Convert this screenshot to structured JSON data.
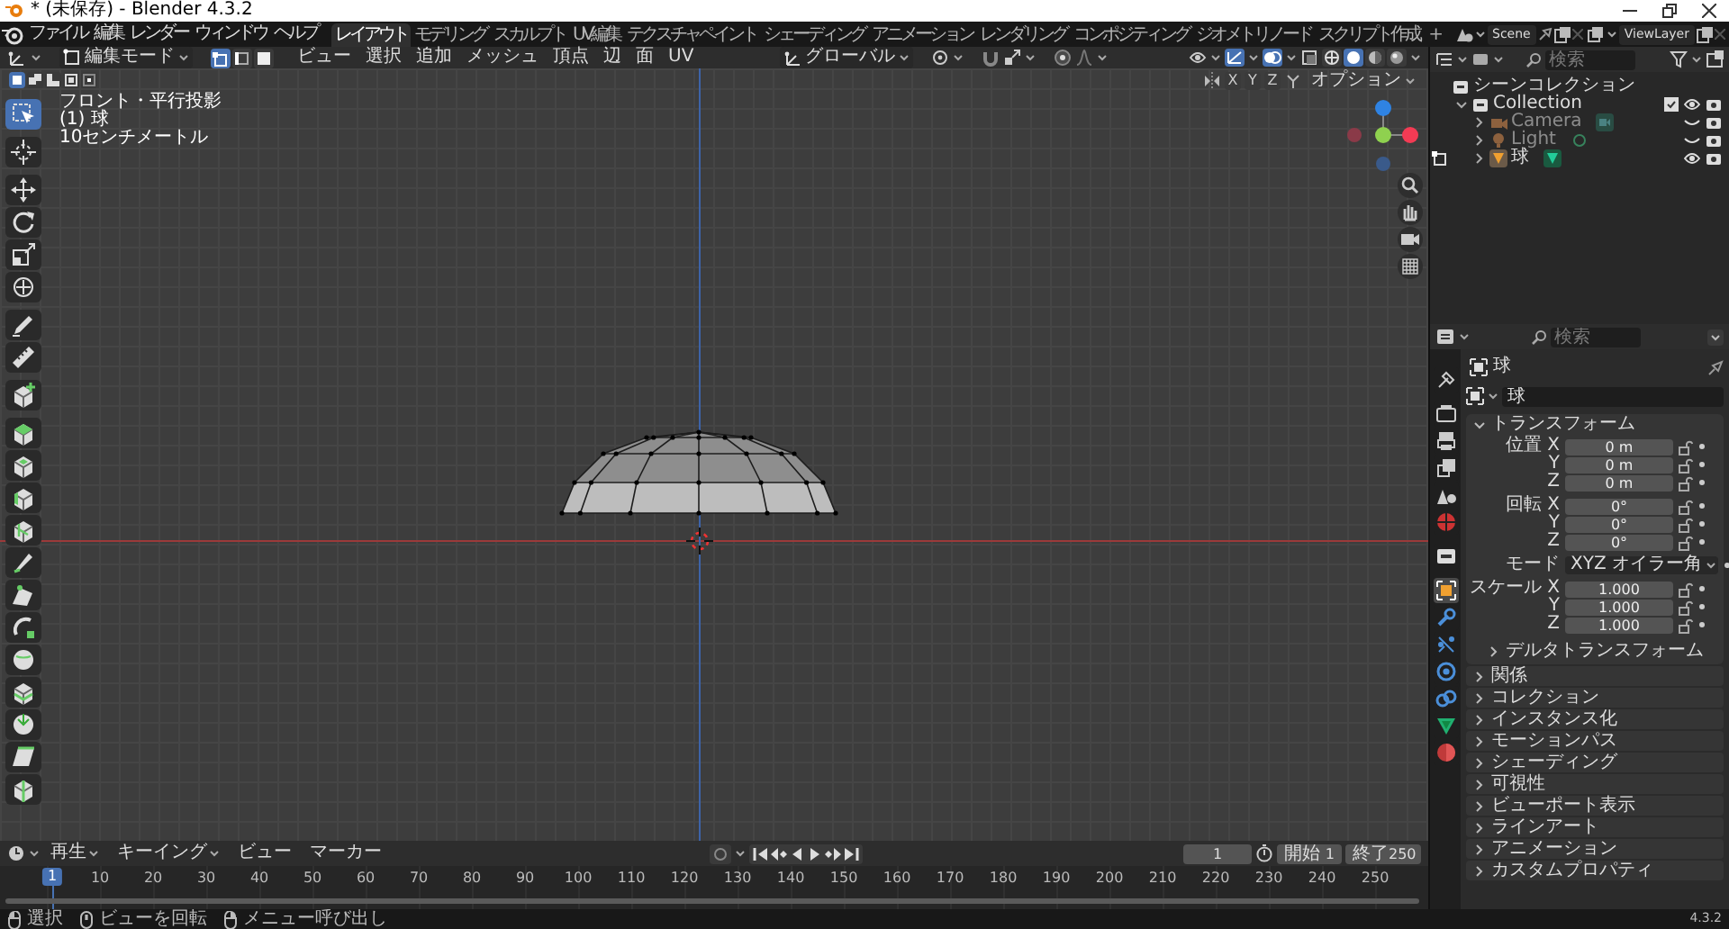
{
  "window": {
    "title": "* (未保存) - Blender 4.3.2"
  },
  "menu": [
    "ファイル",
    "編集",
    "レンダー",
    "ウィンドウ",
    "ヘルプ"
  ],
  "workspaces": [
    {
      "label": "レイアウト",
      "selected": true
    },
    {
      "label": "モデリング",
      "selected": false
    },
    {
      "label": "スカルプト",
      "selected": false
    },
    {
      "label": "UV編集",
      "selected": false
    },
    {
      "label": "テクスチャペイント",
      "selected": false
    },
    {
      "label": "シェーディング",
      "selected": false
    },
    {
      "label": "アニメーション",
      "selected": false
    },
    {
      "label": "レンダリング",
      "selected": false
    },
    {
      "label": "コンポジティング",
      "selected": false
    },
    {
      "label": "ジオメトリノード",
      "selected": false
    },
    {
      "label": "スクリプト作成",
      "selected": false
    }
  ],
  "add_workspace": "+",
  "scene": {
    "name": "Scene"
  },
  "view_layer": {
    "name": "ViewLayer"
  },
  "viewport": {
    "mode": "編集モード",
    "select_modes": [
      {
        "kind": "vertex",
        "selected": true
      },
      {
        "kind": "edge",
        "selected": false
      },
      {
        "kind": "face",
        "selected": false
      }
    ],
    "menus": [
      "ビュー",
      "選択",
      "追加",
      "メッシュ",
      "頂点",
      "辺",
      "面",
      "UV"
    ],
    "orientation": "グローバル",
    "select_ops": [
      {
        "kind": "set",
        "selected": true
      },
      {
        "kind": "extend",
        "selected": false
      },
      {
        "kind": "subtract",
        "selected": false
      },
      {
        "kind": "invert",
        "selected": false
      },
      {
        "kind": "intersect",
        "selected": false
      }
    ],
    "mirror_axes": [
      {
        "label": "X",
        "on": false
      },
      {
        "label": "Y",
        "on": false
      },
      {
        "label": "Z",
        "on": false
      }
    ],
    "options": "オプション",
    "gizmos_on": true,
    "overlays_on": true,
    "shading": [
      {
        "kind": "wireframe",
        "selected": false
      },
      {
        "kind": "solid",
        "selected": true
      },
      {
        "kind": "material",
        "selected": false
      },
      {
        "kind": "rendered",
        "selected": false
      }
    ],
    "info": [
      "フロント・平行投影",
      "(1) 球",
      "10センチメートル"
    ],
    "tool_groups": [
      [
        {
          "kind": "select",
          "selected": true
        }
      ],
      [
        {
          "kind": "cursor",
          "selected": false
        }
      ],
      [
        {
          "kind": "move",
          "selected": false
        },
        {
          "kind": "rotate",
          "selected": false
        },
        {
          "kind": "scale",
          "selected": false
        },
        {
          "kind": "transform",
          "selected": false
        }
      ],
      [
        {
          "kind": "annotate",
          "selected": false
        },
        {
          "kind": "measure",
          "selected": false
        }
      ],
      [
        {
          "kind": "add_cube",
          "selected": false
        }
      ],
      [
        {
          "kind": "extrude",
          "selected": false
        },
        {
          "kind": "inset",
          "selected": false
        },
        {
          "kind": "bevel",
          "selected": false
        },
        {
          "kind": "loop_cut",
          "selected": false
        },
        {
          "kind": "knife",
          "selected": false
        },
        {
          "kind": "poly_build",
          "selected": false
        },
        {
          "kind": "spin",
          "selected": false
        },
        {
          "kind": "smooth",
          "selected": false
        },
        {
          "kind": "edge_slide",
          "selected": false
        },
        {
          "kind": "shrink",
          "selected": false
        },
        {
          "kind": "shear",
          "selected": false
        },
        {
          "kind": "rip",
          "selected": false
        }
      ]
    ]
  },
  "outliner": {
    "search": {
      "placeholder": "検索"
    },
    "root": "シーンコレクション",
    "items": [
      {
        "label": "Collection",
        "kind": "collection",
        "expanded": true,
        "checked": true,
        "visible": true,
        "children": [
          {
            "label": "Camera",
            "kind": "camera",
            "expanded": false,
            "visible": false,
            "editing": false
          },
          {
            "label": "Light",
            "kind": "light",
            "expanded": false,
            "visible": false,
            "editing": false
          },
          {
            "label": "球",
            "kind": "mesh",
            "expanded": false,
            "visible": true,
            "editing": true
          }
        ]
      }
    ]
  },
  "properties": {
    "search": {
      "placeholder": "検索"
    },
    "tabs": [
      {
        "kind": "tool",
        "selected": false
      },
      {
        "kind": "render",
        "selected": false
      },
      {
        "kind": "output",
        "selected": false
      },
      {
        "kind": "view_layer",
        "selected": false
      },
      {
        "kind": "scene",
        "selected": false
      },
      {
        "kind": "world",
        "selected": false
      },
      {
        "kind": "collection",
        "selected": false
      },
      {
        "kind": "object",
        "selected": true
      },
      {
        "kind": "modifiers",
        "selected": false
      },
      {
        "kind": "particles",
        "selected": false
      },
      {
        "kind": "physics",
        "selected": false
      },
      {
        "kind": "constraints",
        "selected": false
      },
      {
        "kind": "data",
        "selected": false
      },
      {
        "kind": "material",
        "selected": false
      }
    ],
    "object": "球",
    "name": "球",
    "transform": {
      "title": "トランスフォーム",
      "expanded": true,
      "groups": [
        {
          "rows": [
            {
              "kind": "field",
              "label": "位置 X",
              "value": "0 m"
            },
            {
              "kind": "field",
              "label": "Y",
              "value": "0 m"
            },
            {
              "kind": "field",
              "label": "Z",
              "value": "0 m"
            }
          ]
        },
        {
          "rows": [
            {
              "kind": "field",
              "label": "回転 X",
              "value": "0°"
            },
            {
              "kind": "field",
              "label": "Y",
              "value": "0°"
            },
            {
              "kind": "field",
              "label": "Z",
              "value": "0°"
            }
          ]
        },
        {
          "rows": [
            {
              "kind": "dropdown",
              "label": "モード",
              "value": "XYZ オイラー角"
            }
          ]
        },
        {
          "rows": [
            {
              "kind": "field",
              "label": "スケール X",
              "value": "1.000"
            },
            {
              "kind": "field",
              "label": "Y",
              "value": "1.000"
            },
            {
              "kind": "field",
              "label": "Z",
              "value": "1.000"
            }
          ]
        }
      ],
      "subpanel": {
        "title": "デルタトランスフォーム",
        "expanded": false
      }
    },
    "panels": [
      {
        "title": "関係",
        "expanded": false
      },
      {
        "title": "コレクション",
        "expanded": false
      },
      {
        "title": "インスタンス化",
        "expanded": false
      },
      {
        "title": "モーションパス",
        "expanded": false
      },
      {
        "title": "シェーディング",
        "expanded": false
      },
      {
        "title": "可視性",
        "expanded": false
      },
      {
        "title": "ビューポート表示",
        "expanded": false
      },
      {
        "title": "ラインアート",
        "expanded": false
      },
      {
        "title": "アニメーション",
        "expanded": false
      },
      {
        "title": "カスタムプロパティ",
        "expanded": false
      }
    ]
  },
  "timeline": {
    "menus": [
      {
        "label": "再生",
        "dropdown": true
      },
      {
        "label": "キーイング",
        "dropdown": true
      },
      {
        "label": "ビュー",
        "dropdown": false
      },
      {
        "label": "マーカー",
        "dropdown": false
      }
    ],
    "auto_key": false,
    "current_frame": "1",
    "start": {
      "label": "開始",
      "value": "1"
    },
    "end": {
      "label": "終了",
      "value": "250"
    },
    "playhead": "1",
    "ruler": [
      "10",
      "20",
      "30",
      "40",
      "50",
      "60",
      "70",
      "80",
      "90",
      "100",
      "110",
      "120",
      "130",
      "140",
      "150",
      "160",
      "170",
      "180",
      "190",
      "200",
      "210",
      "220",
      "230",
      "240",
      "250"
    ]
  },
  "status_bar": {
    "hints": [
      {
        "kind": "left",
        "label": "選択"
      },
      {
        "kind": "middle",
        "label": "ビューを回転"
      },
      {
        "kind": "right",
        "label": "メニュー呼び出し"
      }
    ],
    "version": "4.3.2"
  }
}
